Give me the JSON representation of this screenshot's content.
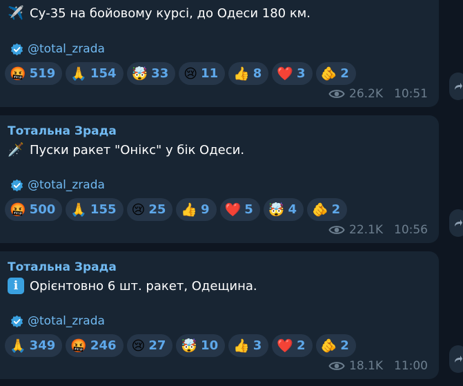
{
  "messages": [
    {
      "author": "",
      "icon": "jet-icon",
      "emoji": "✈️",
      "text": "Су-35 на бойовому курсі, до Одеси 180 км.",
      "handle": "@total_zrada",
      "reactions": [
        {
          "emoji": "🤬",
          "name": "angry-face-icon",
          "count": "519"
        },
        {
          "emoji": "🙏",
          "name": "folded-hands-icon",
          "count": "154"
        },
        {
          "emoji": "🤯",
          "name": "exploding-head-icon",
          "count": "33"
        },
        {
          "emoji": "😢",
          "name": "crying-face-icon",
          "count": "11"
        },
        {
          "emoji": "👍",
          "name": "thumbs-up-icon",
          "count": "8"
        },
        {
          "emoji": "❤️",
          "name": "red-heart-icon",
          "count": "3"
        },
        {
          "emoji": "🫵",
          "name": "pointing-hand-icon",
          "count": "2"
        }
      ],
      "views": "26.2K",
      "time": "10:51"
    },
    {
      "author": "Тотальна Зрада",
      "icon": "dagger-icon",
      "emoji": "🗡️",
      "text": "Пуски ракет \"Онікс\" у бік Одеси.",
      "handle": "@total_zrada",
      "reactions": [
        {
          "emoji": "🤬",
          "name": "angry-face-icon",
          "count": "500"
        },
        {
          "emoji": "🙏",
          "name": "folded-hands-icon",
          "count": "155"
        },
        {
          "emoji": "😢",
          "name": "crying-face-icon",
          "count": "25"
        },
        {
          "emoji": "👍",
          "name": "thumbs-up-icon",
          "count": "9"
        },
        {
          "emoji": "❤️",
          "name": "red-heart-icon",
          "count": "5"
        },
        {
          "emoji": "🤯",
          "name": "exploding-head-icon",
          "count": "4"
        },
        {
          "emoji": "🫵",
          "name": "pointing-hand-icon",
          "count": "2"
        }
      ],
      "views": "22.1K",
      "time": "10:56"
    },
    {
      "author": "Тотальна Зрада",
      "icon": "info-icon",
      "emoji": "i",
      "text": "Орієнтовно 6 шт. ракет, Одещина.",
      "handle": "@total_zrada",
      "reactions": [
        {
          "emoji": "🙏",
          "name": "folded-hands-icon",
          "count": "349"
        },
        {
          "emoji": "🤬",
          "name": "angry-face-icon",
          "count": "246"
        },
        {
          "emoji": "😢",
          "name": "crying-face-icon",
          "count": "27"
        },
        {
          "emoji": "🤯",
          "name": "exploding-head-icon",
          "count": "10"
        },
        {
          "emoji": "👍",
          "name": "thumbs-up-icon",
          "count": "3"
        },
        {
          "emoji": "❤️",
          "name": "red-heart-icon",
          "count": "2"
        },
        {
          "emoji": "🫵",
          "name": "pointing-hand-icon",
          "count": "2"
        }
      ],
      "views": "18.1K",
      "time": "11:00"
    }
  ],
  "colors": {
    "background": "#0e1621",
    "bubble": "#182533",
    "author": "#71baf2",
    "reaction_bg": "#263649",
    "reaction_count": "#5ea8ea",
    "meta": "#6d7f8f",
    "verified": "#3aa1e0"
  }
}
